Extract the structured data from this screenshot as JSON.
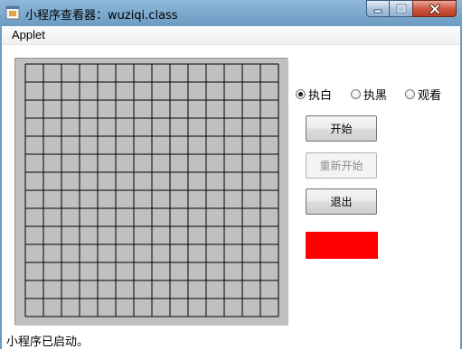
{
  "window": {
    "title": "小程序查看器：wuziqi.class",
    "minimize_icon": "minimize-icon",
    "maximize_icon": "maximize-icon",
    "close_icon": "close-icon"
  },
  "menu": {
    "items": [
      {
        "label": "Applet"
      }
    ]
  },
  "board": {
    "rows": 15,
    "cols": 15,
    "line_color": "#000000",
    "background": "#c0c0c0"
  },
  "controls": {
    "radios": [
      {
        "label": "执白",
        "checked": true
      },
      {
        "label": "执黑",
        "checked": false
      },
      {
        "label": "观看",
        "checked": false
      }
    ],
    "buttons": [
      {
        "label": "开始",
        "enabled": true
      },
      {
        "label": "重新开始",
        "enabled": false
      },
      {
        "label": "退出",
        "enabled": true
      }
    ],
    "turn_indicator_color": "#ff0000"
  },
  "status": {
    "text": "小程序已启动。"
  }
}
